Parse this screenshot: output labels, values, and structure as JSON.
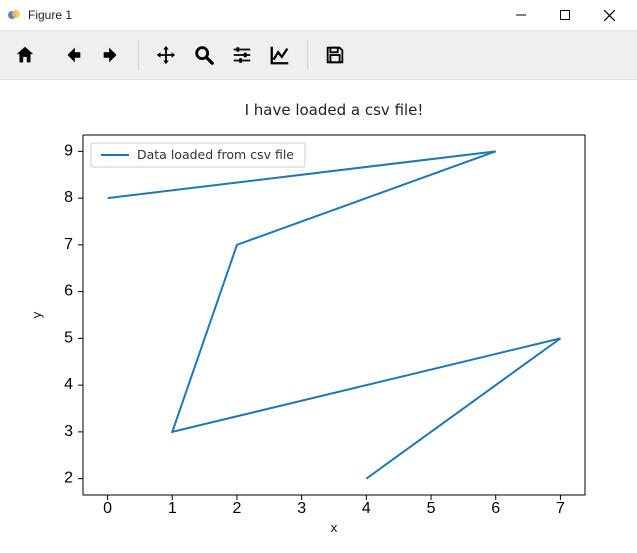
{
  "window": {
    "title": "Figure 1",
    "minimize_label": "Minimize",
    "maximize_label": "Maximize",
    "close_label": "Close"
  },
  "toolbar": {
    "home_label": "Home",
    "back_label": "Back",
    "forward_label": "Forward",
    "pan_label": "Pan",
    "zoom_label": "Zoom",
    "configure_label": "Configure subplots",
    "edit_label": "Edit axis",
    "save_label": "Save"
  },
  "chart_data": {
    "type": "line",
    "title": "I have loaded a csv file!",
    "xlabel": "x",
    "ylabel": "y",
    "xlim": [
      -0.38,
      7.38
    ],
    "ylim": [
      1.65,
      9.35
    ],
    "xticks": [
      0,
      1,
      2,
      3,
      4,
      5,
      6,
      7
    ],
    "yticks": [
      2,
      3,
      4,
      5,
      6,
      7,
      8,
      9
    ],
    "series": [
      {
        "name": "Data loaded from csv file",
        "color": "#1f77b4",
        "x": [
          0,
          6,
          2,
          1,
          7,
          4,
          7
        ],
        "y": [
          8,
          9,
          7,
          3,
          5,
          2,
          5
        ]
      }
    ],
    "legend_position": "upper left"
  }
}
